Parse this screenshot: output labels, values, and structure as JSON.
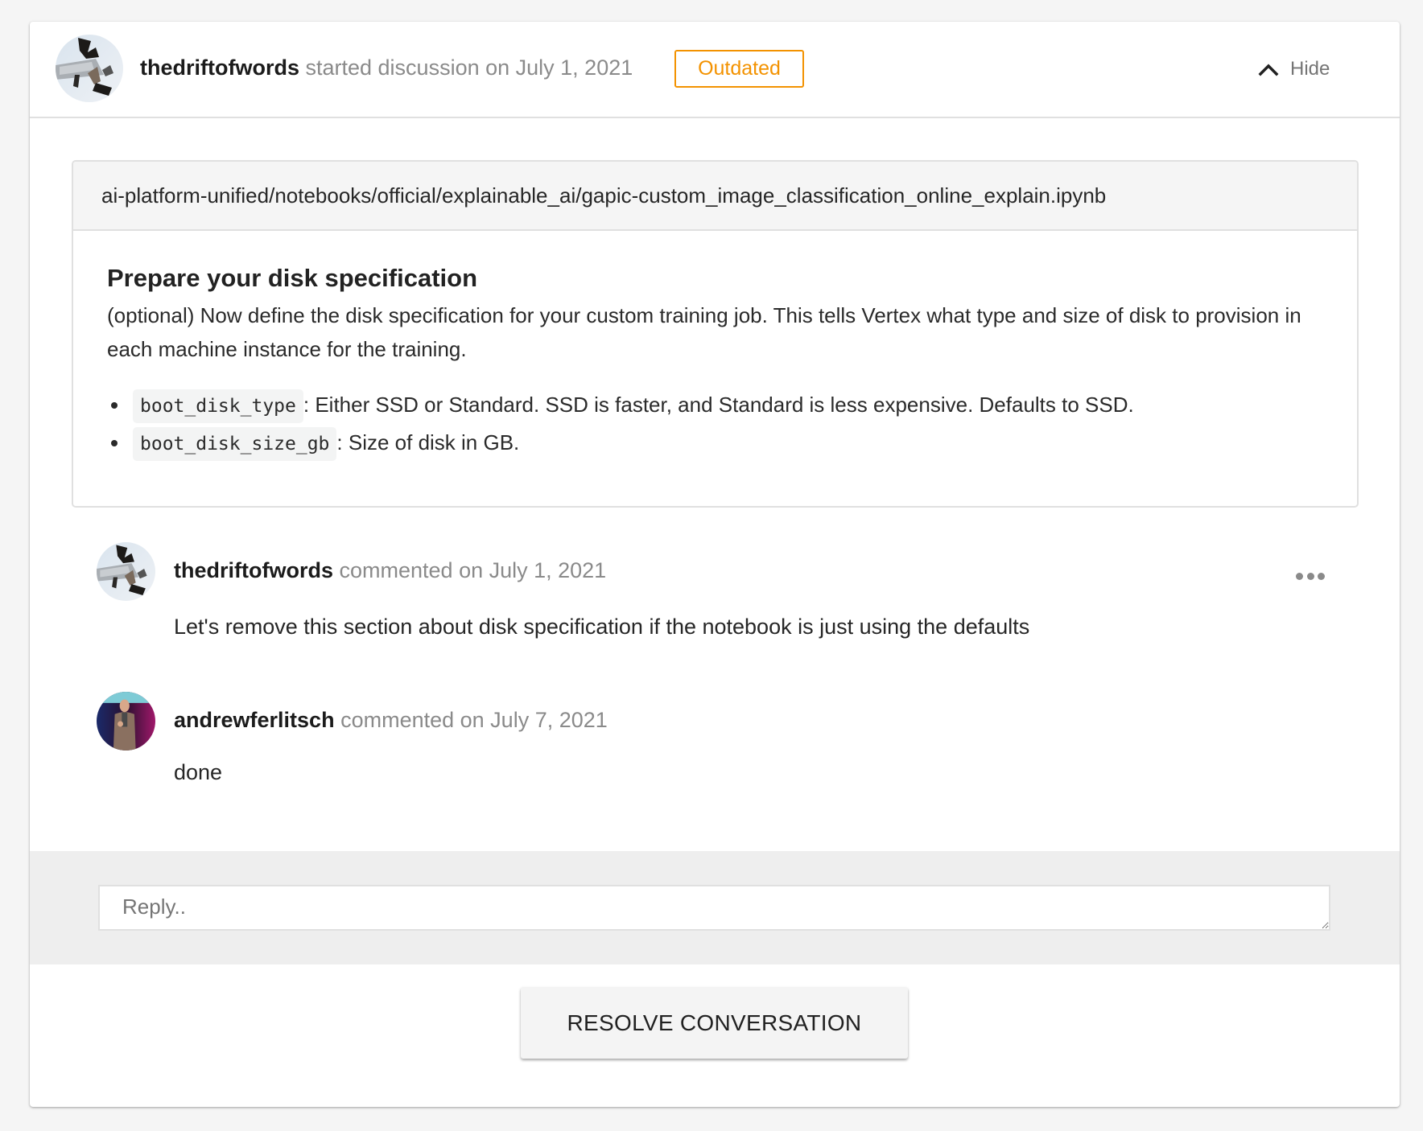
{
  "discussion": {
    "author": "thedriftofwords",
    "action": "started discussion on July 1, 2021",
    "status_badge": "Outdated",
    "hide_label": "Hide",
    "colors": {
      "badge": "#f39200",
      "page_bg": "#f5f5f5",
      "reply_bg": "#eeeeee"
    }
  },
  "file": {
    "path": "ai-platform-unified/notebooks/official/explainable_ai/gapic-custom_image_classification_online_explain.ipynb",
    "heading": "Prepare your disk specification",
    "paragraph": "(optional) Now define the disk specification for your custom training job. This tells Vertex what type and size of disk to provision in each machine instance for the training.",
    "bullets": [
      {
        "code": "boot_disk_type",
        "text": ": Either SSD or Standard. SSD is faster, and Standard is less expensive. Defaults to SSD."
      },
      {
        "code": "boot_disk_size_gb",
        "text": ": Size of disk in GB."
      }
    ]
  },
  "comments": [
    {
      "author": "thedriftofwords",
      "meta": "commented on July 1, 2021",
      "body": "Let's remove this section about disk specification if the notebook is just using the defaults",
      "avatar_icon": "abstract-sculpture-avatar"
    },
    {
      "author": "andrewferlitsch",
      "meta": "commented on July 7, 2021",
      "body": "done",
      "avatar_icon": "speaker-photo-avatar"
    }
  ],
  "reply": {
    "placeholder": "Reply..",
    "value": ""
  },
  "actions": {
    "resolve_label": "RESOLVE CONVERSATION"
  }
}
